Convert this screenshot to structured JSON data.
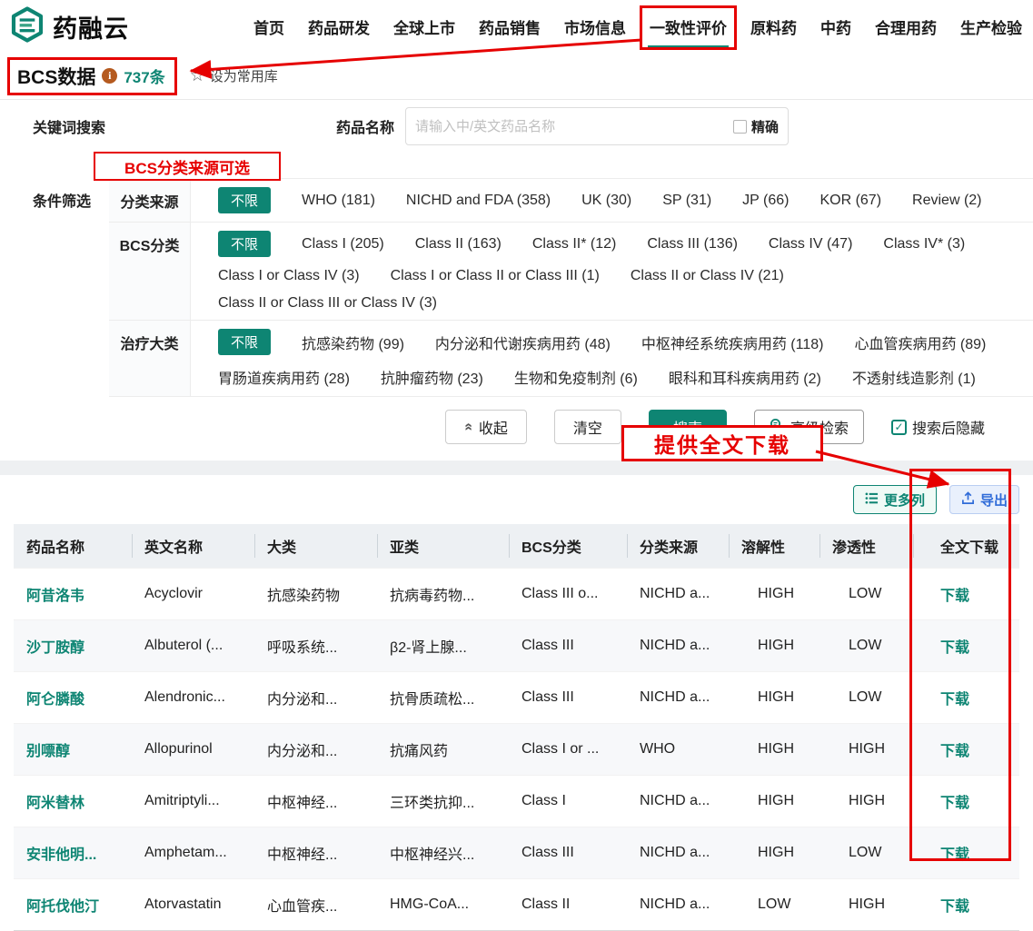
{
  "brand": {
    "name": "药融云"
  },
  "nav": {
    "items": [
      {
        "label": "首页"
      },
      {
        "label": "药品研发"
      },
      {
        "label": "全球上市"
      },
      {
        "label": "药品销售"
      },
      {
        "label": "市场信息"
      },
      {
        "label": "一致性评价",
        "active": true
      },
      {
        "label": "原料药"
      },
      {
        "label": "中药"
      },
      {
        "label": "合理用药"
      },
      {
        "label": "生产检验"
      }
    ]
  },
  "page_header": {
    "title": "BCS数据",
    "count": "737条",
    "favorite_label": "设为常用库"
  },
  "search": {
    "keyword_label": "关键词搜索",
    "filter_label": "条件筛选",
    "drug_name_label": "药品名称",
    "placeholder": "请输入中/英文药品名称",
    "exact_label": "精确"
  },
  "annotations": {
    "source_note": "BCS分类来源可选",
    "download_note": "提供全文下载"
  },
  "filters": [
    {
      "label": "分类来源",
      "unlimited": "不限",
      "options": [
        "WHO (181)",
        "NICHD and FDA (358)",
        "UK (30)",
        "SP (31)",
        "JP (66)",
        "KOR (67)",
        "Review (2)"
      ]
    },
    {
      "label": "BCS分类",
      "unlimited": "不限",
      "options": [
        "Class I (205)",
        "Class II (163)",
        "Class II* (12)",
        "Class III (136)",
        "Class IV (47)",
        "Class IV* (3)",
        "Class I or Class IV (3)",
        "Class I or Class II or Class III (1)",
        "Class II or Class IV (21)",
        "Class II or Class III or Class IV (3)"
      ]
    },
    {
      "label": "治疗大类",
      "unlimited": "不限",
      "options": [
        "抗感染药物 (99)",
        "内分泌和代谢疾病用药 (48)",
        "中枢神经系统疾病用药 (118)",
        "心血管疾病用药 (89)",
        "胃肠道疾病用药 (28)",
        "抗肿瘤药物 (23)",
        "生物和免疫制剂 (6)",
        "眼科和耳科疾病用药 (2)",
        "不透射线造影剂 (1)"
      ]
    }
  ],
  "actions": {
    "collapse": "收起",
    "clear": "清空",
    "search": "搜索",
    "advanced": "高级检索",
    "hide_after_search": "搜索后隐藏"
  },
  "toolbar": {
    "more_columns": "更多列",
    "export": "导出"
  },
  "table": {
    "headers": [
      "药品名称",
      "英文名称",
      "大类",
      "亚类",
      "BCS分类",
      "分类来源",
      "溶解性",
      "渗透性",
      "全文下载"
    ],
    "download_label": "下载",
    "rows": [
      [
        "阿昔洛韦",
        "Acyclovir",
        "抗感染药物",
        "抗病毒药物...",
        "Class III o...",
        "NICHD a...",
        "HIGH",
        "LOW"
      ],
      [
        "沙丁胺醇",
        "Albuterol (...",
        "呼吸系统...",
        "β2-肾上腺...",
        "Class III",
        "NICHD a...",
        "HIGH",
        "LOW"
      ],
      [
        "阿仑膦酸",
        "Alendronic...",
        "内分泌和...",
        "抗骨质疏松...",
        "Class III",
        "NICHD a...",
        "HIGH",
        "LOW"
      ],
      [
        "别嘌醇",
        "Allopurinol",
        "内分泌和...",
        "抗痛风药",
        "Class I or ...",
        "WHO",
        "HIGH",
        "HIGH"
      ],
      [
        "阿米替林",
        "Amitriptyli...",
        "中枢神经...",
        "三环类抗抑...",
        "Class I",
        "NICHD a...",
        "HIGH",
        "HIGH"
      ],
      [
        "安非他明...",
        "Amphetam...",
        "中枢神经...",
        "中枢神经兴...",
        "Class III",
        "NICHD a...",
        "HIGH",
        "LOW"
      ],
      [
        "阿托伐他汀",
        "Atorvastatin",
        "心血管疾...",
        "HMG-CoA...",
        "Class II",
        "NICHD a...",
        "LOW",
        "HIGH"
      ]
    ]
  },
  "icons": {
    "favorite_star": "☆",
    "info": "i",
    "collapse_chevrons": "«",
    "checkbox_check": "✓"
  },
  "colors": {
    "brand_teal": "#0e8573",
    "annotation_red": "#e60000",
    "export_blue": "#2f6bd8",
    "info_orange": "#b55a1f"
  }
}
